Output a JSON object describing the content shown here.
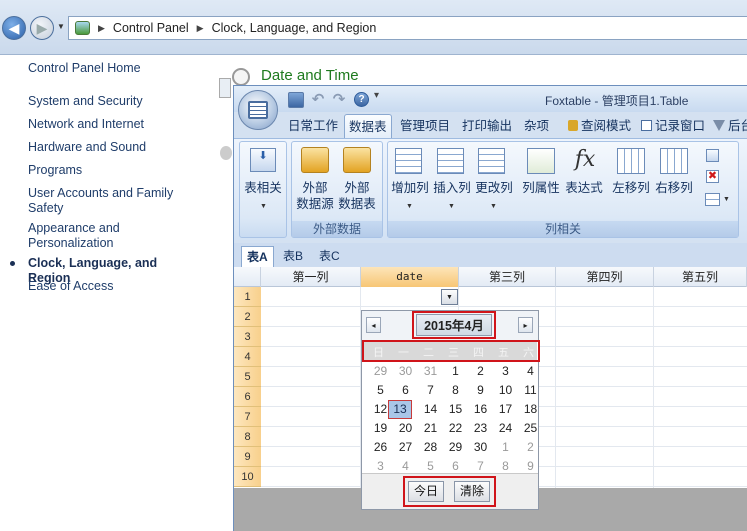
{
  "explorer": {
    "breadcrumb": [
      "Control Panel",
      "Clock, Language, and Region"
    ],
    "left_nav": [
      "Control Panel Home",
      "System and Security",
      "Network and Internet",
      "Hardware and Sound",
      "Programs",
      "User Accounts and Family Safety",
      "Appearance and Personalization",
      "Clock, Language, and Region",
      "Ease of Access"
    ],
    "current_item": "Clock, Language, and Region",
    "section_title": "Date and Time"
  },
  "foxtable": {
    "title": "Foxtable - 管理项目1.Table",
    "tabs": [
      "日常工作",
      "数据表",
      "管理项目",
      "打印输出",
      "杂项",
      "查阅模式",
      "记录窗口",
      "后台"
    ],
    "active_tab": "数据表",
    "ribbon": {
      "table_related": "表相关",
      "ext_source": "外部\n数据源",
      "ext_table": "外部\n数据表",
      "group_external": "外部数据",
      "add_col": "增加列",
      "insert_col": "插入列",
      "change_col": "更改列",
      "col_props": "列属性",
      "expression": "表达式",
      "move_left": "左移列",
      "move_right": "右移列",
      "group_columns": "列相关",
      "fx_symbol": "fx"
    },
    "sheet_tabs": [
      "表A",
      "表B",
      "表C"
    ],
    "active_sheet": "表A",
    "columns": [
      "第一列",
      "date",
      "第三列",
      "第四列",
      "第五列"
    ],
    "rows": [
      "1",
      "2",
      "3",
      "4",
      "5",
      "6",
      "7",
      "8",
      "9",
      "10"
    ]
  },
  "calendar": {
    "month_label": "2015年4月",
    "prev": "◂",
    "next": "▸",
    "weekdays": [
      "日",
      "一",
      "二",
      "三",
      "四",
      "五",
      "六"
    ],
    "weeks": [
      [
        "29",
        "30",
        "31",
        "1",
        "2",
        "3",
        "4"
      ],
      [
        "5",
        "6",
        "7",
        "8",
        "9",
        "10",
        "11"
      ],
      [
        "12",
        "13",
        "14",
        "15",
        "16",
        "17",
        "18"
      ],
      [
        "19",
        "20",
        "21",
        "22",
        "23",
        "24",
        "25"
      ],
      [
        "26",
        "27",
        "28",
        "29",
        "30",
        "1",
        "2"
      ],
      [
        "3",
        "4",
        "5",
        "6",
        "7",
        "8",
        "9"
      ]
    ],
    "selected_day": "13",
    "today_button": "今日",
    "clear_button": "清除"
  }
}
